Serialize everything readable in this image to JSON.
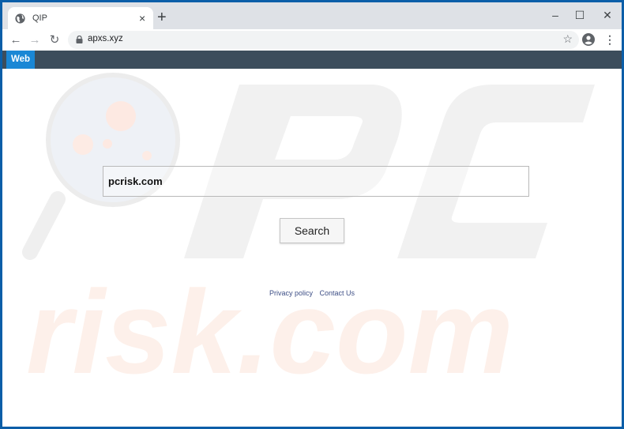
{
  "browser": {
    "tab": {
      "title": "QIP",
      "favicon": "globe-icon",
      "close_icon": "×"
    },
    "new_tab_icon": "+",
    "window_controls": {
      "minimize": "–",
      "maximize": "☐",
      "close": "✕"
    },
    "nav": {
      "back": "←",
      "forward": "→",
      "reload": "↻"
    },
    "address": {
      "url": "apxs.xyz",
      "lock_icon": "lock-icon",
      "star_icon": "☆"
    },
    "menu_icon": "⋮"
  },
  "page": {
    "navbar": {
      "active_tab": "Web"
    },
    "search": {
      "value": "pcrisk.com",
      "button_label": "Search"
    },
    "footer_links": [
      "Privacy policy",
      "Contact Us"
    ],
    "watermark_text": "PC risk.com"
  },
  "colors": {
    "window_frame": "#0b5ea8",
    "navbar": "#3c4d5c",
    "active_tab": "#1a87d5",
    "link": "#3e4f86"
  }
}
